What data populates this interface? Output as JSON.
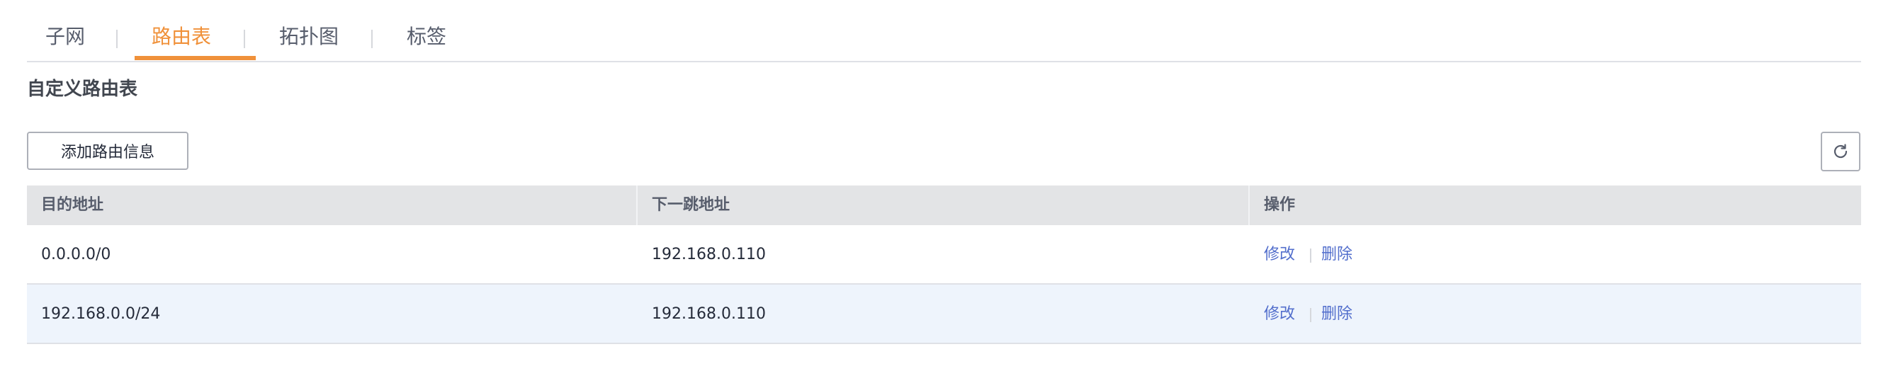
{
  "tabs": [
    {
      "label": "子网",
      "active": false
    },
    {
      "label": "路由表",
      "active": true
    },
    {
      "label": "拓扑图",
      "active": false
    },
    {
      "label": "标签",
      "active": false
    }
  ],
  "section": {
    "title": "自定义路由表"
  },
  "toolbar": {
    "add_label": "添加路由信息",
    "refresh_icon": "refresh-icon"
  },
  "table": {
    "headers": [
      "目的地址",
      "下一跳地址",
      "操作"
    ],
    "rows": [
      {
        "destination": "0.0.0.0/0",
        "next_hop": "192.168.0.110",
        "edit": "修改",
        "delete": "删除"
      },
      {
        "destination": "192.168.0.0/24",
        "next_hop": "192.168.0.110",
        "edit": "修改",
        "delete": "删除"
      }
    ]
  },
  "colors": {
    "accent": "#f0913a",
    "link": "#526ecc",
    "header_bg": "#e3e4e6",
    "row_highlight": "#eef4fc"
  }
}
